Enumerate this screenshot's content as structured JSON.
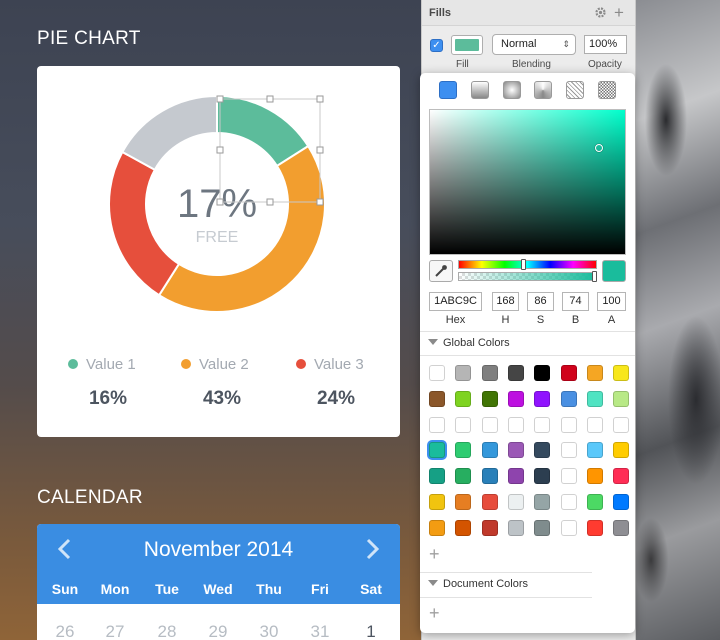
{
  "pie_section": {
    "title": "PIE CHART"
  },
  "chart_data": {
    "type": "pie",
    "center_value": "17%",
    "center_label": "FREE",
    "segments": [
      {
        "name": "Value 1",
        "percent": 16,
        "label": "16%",
        "color": "#5cbc9b"
      },
      {
        "name": "Value 2",
        "percent": 43,
        "label": "43%",
        "color": "#f29e2f"
      },
      {
        "name": "Value 3",
        "percent": 24,
        "label": "24%",
        "color": "#e64f3c"
      },
      {
        "name": "Free",
        "percent": 17,
        "color": "#c5c9cf"
      }
    ]
  },
  "calendar_section": {
    "title": "CALENDAR"
  },
  "calendar": {
    "month": "November 2014",
    "prev_icon": "chevron-left-icon",
    "next_icon": "chevron-right-icon",
    "weekdays": [
      "Sun",
      "Mon",
      "Tue",
      "Wed",
      "Thu",
      "Fri",
      "Sat"
    ],
    "days": [
      "26",
      "27",
      "28",
      "29",
      "30",
      "31",
      "1"
    ],
    "accent": "#3a8de2"
  },
  "inspector": {
    "section_title": "Fills",
    "fill": {
      "enabled": true,
      "color": "#5cbc9b",
      "blending": "Normal",
      "opacity": "100%",
      "labels": {
        "fill": "Fill",
        "blending": "Blending",
        "opacity": "Opacity"
      }
    }
  },
  "color_picker": {
    "fill_types": [
      "solid-color-icon",
      "linear-gradient-icon",
      "radial-gradient-icon",
      "angular-gradient-icon",
      "pattern-fill-icon",
      "noise-fill-icon"
    ],
    "current_color": "#1abc9c",
    "hue": 168,
    "alpha": 1.0,
    "fields": [
      {
        "label": "Hex",
        "value": "1ABC9C"
      },
      {
        "label": "H",
        "value": "168"
      },
      {
        "label": "S",
        "value": "86"
      },
      {
        "label": "B",
        "value": "74"
      },
      {
        "label": "A",
        "value": "100"
      }
    ],
    "global_colors_label": "Global Colors",
    "global_colors": [
      [
        "#ffffff",
        "#b5b5b5",
        "#7f7f7f",
        "#454545",
        "#000000",
        "#d0021b",
        "#f5a623",
        "#f8e71c"
      ],
      [
        "#8b572a",
        "#7ed321",
        "#417505",
        "#bd10e0",
        "#9013fe",
        "#4a90e2",
        "#50e3c2",
        "#b8e986"
      ],
      [
        "#ffffff",
        "#ffffff",
        "#ffffff",
        "#ffffff",
        "#ffffff",
        "#ffffff",
        "#ffffff",
        "#ffffff"
      ],
      [
        "#1abc9c",
        "#2ecc71",
        "#3498db",
        "#9b59b6",
        "#34495e",
        "#ffffff",
        "#5ac8fa",
        "#ffcc00"
      ],
      [
        "#16a085",
        "#27ae60",
        "#2980b9",
        "#8e44ad",
        "#2c3e50",
        "#ffffff",
        "#ff9500",
        "#ff2d55"
      ],
      [
        "#f1c40f",
        "#e67e22",
        "#e74c3c",
        "#ecf0f1",
        "#95a5a6",
        "#ffffff",
        "#4cd964",
        "#007aff"
      ],
      [
        "#f39c12",
        "#d35400",
        "#c0392b",
        "#bdc3c7",
        "#7f8c8d",
        "#ffffff",
        "#ff3b30",
        "#8e8e93"
      ]
    ],
    "document_colors_label": "Document Colors"
  }
}
